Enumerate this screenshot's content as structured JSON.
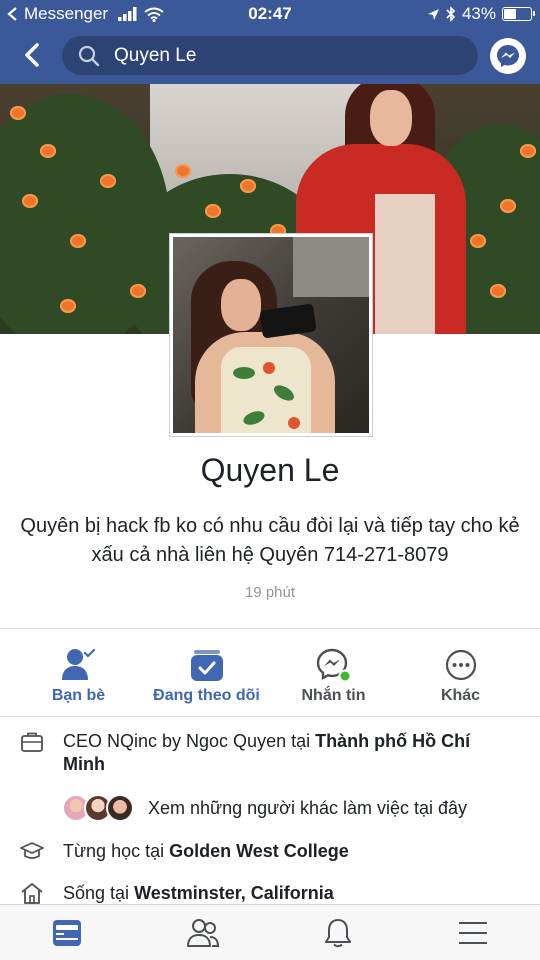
{
  "status_bar": {
    "back_app": "Messenger",
    "time": "02:47",
    "battery": "43%",
    "battery_level": 0.43
  },
  "search": {
    "query": "Quyen Le"
  },
  "profile": {
    "name": "Quyen Le",
    "bio": "Quyên bị hack fb ko có nhu cầu đòi lại và tiếp tay cho kẻ xấu cả nhà liên hệ Quyên 714-271-8079",
    "timestamp": "19 phút"
  },
  "actions": [
    {
      "label": "Bạn bè",
      "icon": "friends-check-icon"
    },
    {
      "label": "Đang theo dõi",
      "icon": "following-icon"
    },
    {
      "label": "Nhắn tin",
      "icon": "messenger-icon"
    },
    {
      "label": "Khác",
      "icon": "more-icon"
    }
  ],
  "details": {
    "work_prefix": "CEO NQinc by Ngoc Quyen tại ",
    "work_place": "Thành phố Hồ Chí Minh",
    "coworkers_text": "Xem những người khác làm việc tại đây",
    "edu_prefix": "Từng học tại ",
    "edu_place": "Golden West College",
    "live_prefix": "Sống tại ",
    "live_place": "Westminster, California"
  },
  "tabs": [
    {
      "icon": "news-feed-icon",
      "active": true
    },
    {
      "icon": "friends-icon",
      "active": false
    },
    {
      "icon": "notifications-bell-icon",
      "active": false
    },
    {
      "icon": "menu-icon",
      "active": false
    }
  ],
  "colors": {
    "brand": "#3b5998",
    "accent": "#4267b2",
    "online": "#42b72a"
  }
}
